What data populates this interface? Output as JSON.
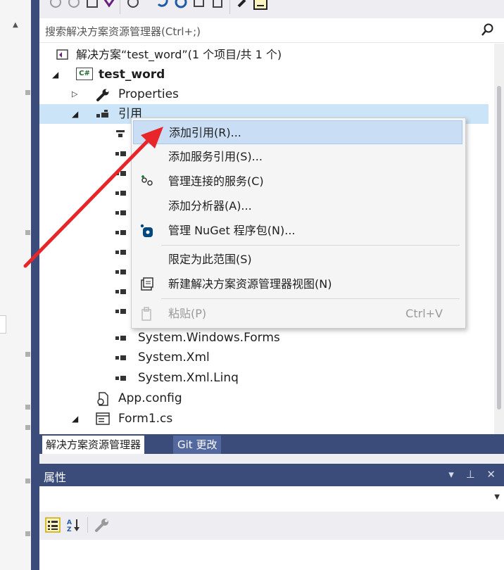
{
  "search": {
    "placeholder": "搜索解决方案资源管理器(Ctrl+;)"
  },
  "tree": {
    "solution": "解决方案“test_word”(1 个项目/共 1 个)",
    "project": "test_word",
    "project_badge": "C#",
    "properties": "Properties",
    "references": "引用",
    "refs": [
      "System.Windows.Forms",
      "System.Xml",
      "System.Xml.Linq"
    ],
    "app_config": "App.config",
    "form1": "Form1.cs"
  },
  "context_menu": {
    "items": [
      {
        "label": "添加引用(R)...",
        "icon": "none",
        "highlighted": true
      },
      {
        "label": "添加服务引用(S)...",
        "icon": "none"
      },
      {
        "label": "管理连接的服务(C)",
        "icon": "connected-services-icon"
      },
      {
        "label": "添加分析器(A)...",
        "icon": "none"
      },
      {
        "label": "管理 NuGet 程序包(N)...",
        "icon": "nuget-icon"
      },
      {
        "label": "限定为此范围(S)",
        "icon": "none"
      },
      {
        "label": "新建解决方案资源管理器视图(N)",
        "icon": "new-view-icon"
      },
      {
        "label": "粘贴(P)",
        "shortcut": "Ctrl+V",
        "icon": "paste-icon",
        "disabled": true
      }
    ]
  },
  "bottom_tabs": {
    "solution_explorer": "解决方案资源管理器",
    "git_changes": "Git 更改"
  },
  "properties": {
    "title": "属性",
    "controls": "▾ ⊥ ✕"
  },
  "colors": {
    "accent": "#3c4c7a",
    "selection": "#cce4f7",
    "menu_highlight": "#c9def5",
    "annotation_arrow": "#e8262a"
  }
}
